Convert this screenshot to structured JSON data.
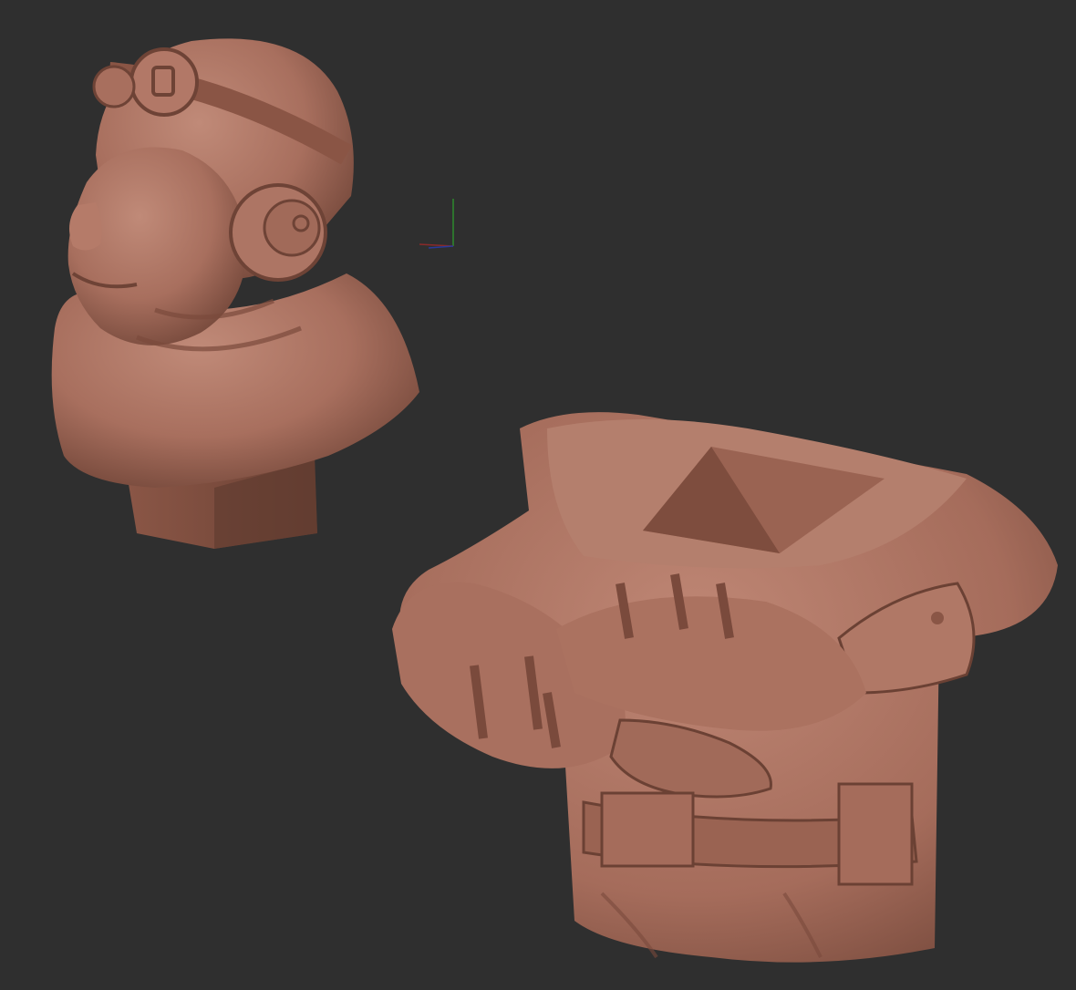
{
  "viewport": {
    "background": "#2f2f2f"
  },
  "models": {
    "head_bust": {
      "icon": "sculpted-head-bust",
      "clay_color": "#a86f5e",
      "shadow_color": "#6e4336",
      "highlight_color": "#c99584"
    },
    "torso": {
      "icon": "sculpted-torso-crossed-arms",
      "clay_color": "#a56c5b",
      "shadow_color": "#6b4134",
      "highlight_color": "#c79280"
    }
  },
  "gizmo": {
    "icon": "axis-gizmo",
    "x_color": "#8a2a2a",
    "y_color": "#2d8a2d",
    "z_color": "#2a3a9a"
  }
}
